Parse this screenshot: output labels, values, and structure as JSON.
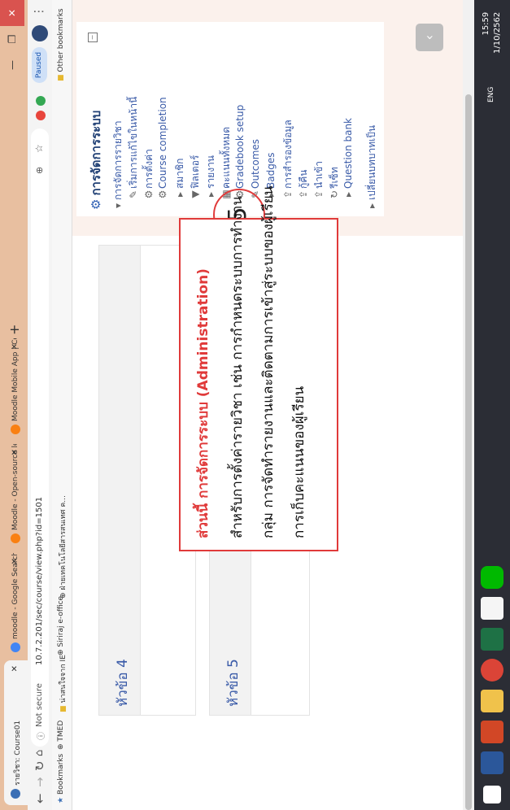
{
  "browser": {
    "tabs": [
      {
        "label": "รายวิชา: Course01",
        "active": true
      },
      {
        "label": "moodle - Google Search",
        "active": false
      },
      {
        "label": "Moodle - Open-source learning",
        "active": false
      },
      {
        "label": "Moodle Mobile App | Converge",
        "active": false
      }
    ],
    "security": "Not secure",
    "url": "10.7.2.201/sec/course/view.php?id=1501",
    "paused_label": "Paused",
    "bookmarks": [
      "Bookmarks",
      "TMED",
      "น่าสนใจจาก IE",
      "Siriraj e-office",
      "ฝ่ายเทคโนโลยีสารสนเทศ ค..."
    ],
    "other_bookmarks": "Other bookmarks"
  },
  "sections": [
    {
      "title": "หัวข้อ 4"
    },
    {
      "title": "หัวข้อ 5"
    }
  ],
  "nav_block": {
    "title": "การจัดการระบบ",
    "items": [
      {
        "label": "การจัดการรายวิชา",
        "icon": "caret-down"
      },
      {
        "label": "เริ่มการแก้ไขในหน้านี้",
        "icon": "pencil"
      },
      {
        "label": "การตั้งค่า",
        "icon": "gear"
      },
      {
        "label": "Course completion",
        "icon": "gear"
      },
      {
        "label": "สมาชิก",
        "icon": "caret-right"
      },
      {
        "label": "ฟิลเตอร์",
        "icon": "filter"
      },
      {
        "label": "รายงาน",
        "icon": "caret-right"
      },
      {
        "label": "คะแนนทั้งหมด",
        "icon": "table"
      },
      {
        "label": "Gradebook setup",
        "icon": "gear"
      },
      {
        "label": "Outcomes",
        "icon": "pencil"
      },
      {
        "label": "Badges",
        "icon": "caret-right"
      },
      {
        "label": "การสำรองข้อมูล",
        "icon": "upload"
      },
      {
        "label": "กู้คืน",
        "icon": "upload"
      },
      {
        "label": "นำเข้า",
        "icon": "upload"
      },
      {
        "label": "รีเซ็ท",
        "icon": "refresh"
      },
      {
        "label": "Question bank",
        "icon": "caret-right"
      },
      {
        "label": "เปลี่ยนบทบาทเป็น",
        "icon": "caret-right"
      }
    ]
  },
  "annotation": {
    "number": "5",
    "heading": "ส่วนนี้ การจัดการระบบ (Administration)",
    "lines": [
      "สำหรับการตั้งค่ารายวิชา เช่น การกำหนดระบบการทำงาน",
      "กลุ่ม การจัดทำรายงานและติดตามการเข้าสู่ระบบของผู้เรียน",
      "การเก็บคะแนนของผู้เรียน"
    ]
  },
  "taskbar": {
    "lang": "ENG",
    "time": "15:59",
    "date": "1/10/2562"
  }
}
